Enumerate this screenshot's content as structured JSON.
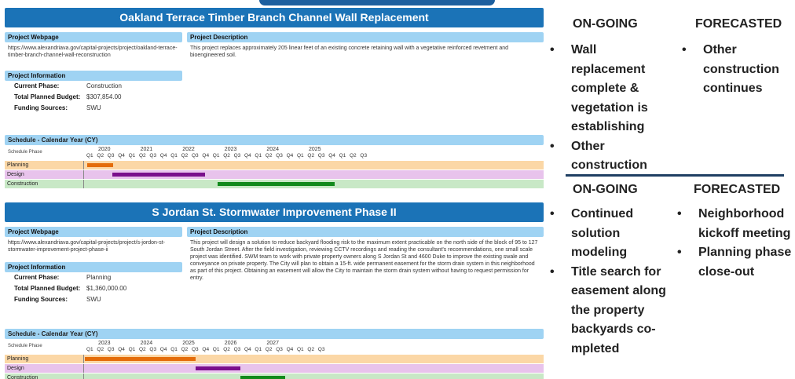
{
  "projects": [
    {
      "title": "Oakland Terrace Timber Branch Channel Wall Replacement",
      "webpage_heading": "Project Webpage",
      "webpage_url": "https://www.alexandriava.gov/capital-projects/project/oakland-terrace-timber-branch-channel-wall-reconstruction",
      "description_heading": "Project Description",
      "description": "This project replaces approximately 205 linear feet of an existing concrete retaining wall with a vegetative reinforced revetment and bioengineered soil.",
      "info_heading": "Project Information",
      "info": [
        {
          "label": "Current Phase:",
          "value": "Construction"
        },
        {
          "label": "Total Planned Budget:",
          "value": "$307,854.00"
        },
        {
          "label": "Funding Sources:",
          "value": "SWU"
        }
      ],
      "schedule_heading": "Schedule - Calendar Year (CY)",
      "phase_heading": "Schedule Phase",
      "years": [
        "2020",
        "2021",
        "2022",
        "2023",
        "2024",
        "2025"
      ],
      "quarter_labels": [
        "Q1",
        "Q2",
        "Q3",
        "Q4",
        "Q1",
        "Q2",
        "Q3",
        "Q4",
        "Q1",
        "Q2",
        "Q3",
        "Q4",
        "Q1",
        "Q2",
        "Q3",
        "Q4",
        "Q1",
        "Q2",
        "Q3",
        "Q4",
        "Q1",
        "Q2",
        "Q3",
        "Q4",
        "Q1",
        "Q2",
        "Q3"
      ],
      "phases": [
        {
          "name": "Planning",
          "row_color": "#fbd7a6",
          "bar_color": "#e46c0a",
          "start_q": 0.25,
          "end_q": 2.7
        },
        {
          "name": "Design",
          "row_color": "#e8c3ec",
          "bar_color": "#7a0f8c",
          "start_q": 2.6,
          "end_q": 11.4
        },
        {
          "name": "Construction",
          "row_color": "#c8e8c6",
          "bar_color": "#118a1c",
          "start_q": 12.6,
          "end_q": 23.7
        }
      ]
    },
    {
      "title": "S Jordan St. Stormwater Improvement Phase II",
      "webpage_heading": "Project Webpage",
      "webpage_url": "https://www.alexandriava.gov/capital-projects/project/s-jordon-st-stormwater-improvement-project-phase-ii",
      "description_heading": "Project Description",
      "description": "This project will design a solution to reduce backyard flooding risk to the maximum extent practicable on the north side of the block of 95 to 127 South Jordan Street. After the field investigation, reviewing CCTV recordings and reading the consultant's recommendations, one small scale project was identified. SWM team to work with private property owners along S Jordan St and 4600 Duke to improve the existing swale and conveyance on private property. The City will plan to obtain a 15-ft. wide permanent easement for the storm drain system in this neighborhood as part of this project. Obtaining an easement will allow the City to maintain the storm drain system without having to request permission for entry.",
      "info_heading": "Project Information",
      "info": [
        {
          "label": "Current Phase:",
          "value": "Planning"
        },
        {
          "label": "Total Planned Budget:",
          "value": "$1,360,000.00"
        },
        {
          "label": "Funding Sources:",
          "value": "SWU"
        }
      ],
      "schedule_heading": "Schedule - Calendar Year (CY)",
      "phase_heading": "Schedule Phase",
      "years": [
        "2023",
        "2024",
        "2025",
        "2026",
        "2027"
      ],
      "quarter_labels": [
        "Q1",
        "Q2",
        "Q3",
        "Q4",
        "Q1",
        "Q2",
        "Q3",
        "Q4",
        "Q1",
        "Q2",
        "Q3",
        "Q4",
        "Q1",
        "Q2",
        "Q3",
        "Q4",
        "Q1",
        "Q2",
        "Q3",
        "Q4",
        "Q1",
        "Q2",
        "Q3"
      ],
      "phases": [
        {
          "name": "Planning",
          "row_color": "#fbd7a6",
          "bar_color": "#e46c0a",
          "start_q": 0.0,
          "end_q": 10.5
        },
        {
          "name": "Design",
          "row_color": "#e8c3ec",
          "bar_color": "#7a0f8c",
          "start_q": 10.5,
          "end_q": 14.8
        },
        {
          "name": "Construction",
          "row_color": "#c8e8c6",
          "bar_color": "#118a1c",
          "start_q": 14.8,
          "end_q": 19.0
        }
      ]
    }
  ],
  "status_panels": [
    {
      "ongoing_heading": "ON-GOING",
      "forecasted_heading": "FORECASTED",
      "ongoing_items": [
        "Wall replacement complete & vegetation is establishing",
        "Other construction"
      ],
      "forecasted_items": [
        "Other construction continues"
      ]
    },
    {
      "ongoing_heading": "ON-GOING",
      "forecasted_heading": "FORECASTED",
      "ongoing_items": [
        "Continued solution modeling",
        "Title search for easement along the property backyards co-mpleted"
      ],
      "forecasted_items": [
        "Neighborhood kickoff meeting",
        "Planning phase close-out"
      ]
    }
  ],
  "bullet_glyph": "•",
  "colors": {
    "title_bar": "#1b73b7",
    "section_header": "#9fd3f3",
    "separator": "#1f3f63"
  }
}
